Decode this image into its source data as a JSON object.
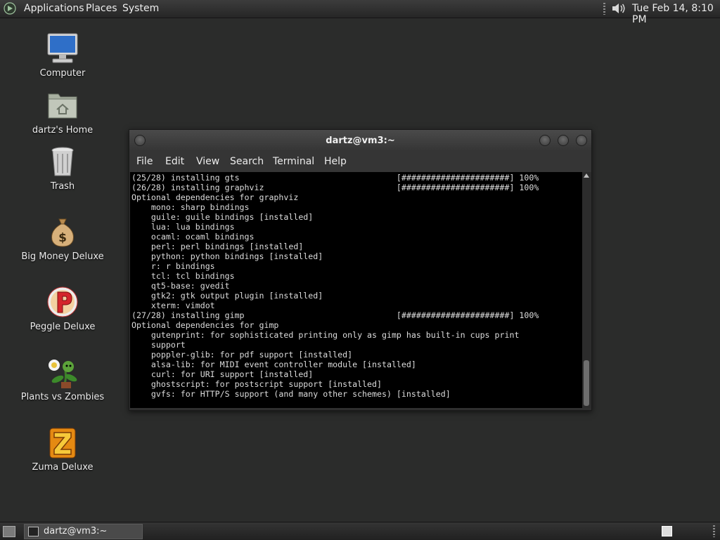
{
  "top_panel": {
    "menus": [
      "Applications",
      "Places",
      "System"
    ],
    "clock": "Tue Feb 14,  8:10 PM"
  },
  "desktop": {
    "icons": [
      {
        "label": "Computer",
        "icon": "computer-icon"
      },
      {
        "label": "dartz's Home",
        "icon": "home-folder-icon"
      },
      {
        "label": "Trash",
        "icon": "trash-icon"
      },
      {
        "label": "Big Money Deluxe",
        "icon": "money-bag-icon"
      },
      {
        "label": "Peggle Deluxe",
        "icon": "peggle-icon"
      },
      {
        "label": "Plants vs Zombies",
        "icon": "plants-vs-zombies-icon"
      },
      {
        "label": "Zuma Deluxe",
        "icon": "zuma-icon"
      }
    ]
  },
  "terminal": {
    "title": "dartz@vm3:~",
    "menu": [
      "File",
      "Edit",
      "View",
      "Search",
      "Terminal",
      "Help"
    ],
    "lines": [
      "(25/28) installing gts                                [######################] 100%",
      "(26/28) installing graphviz                           [######################] 100%",
      "Optional dependencies for graphviz",
      "    mono: sharp bindings",
      "    guile: guile bindings [installed]",
      "    lua: lua bindings",
      "    ocaml: ocaml bindings",
      "    perl: perl bindings [installed]",
      "    python: python bindings [installed]",
      "    r: r bindings",
      "    tcl: tcl bindings",
      "    qt5-base: gvedit",
      "    gtk2: gtk output plugin [installed]",
      "    xterm: vimdot",
      "(27/28) installing gimp                               [######################] 100%",
      "Optional dependencies for gimp",
      "    gutenprint: for sophisticated printing only as gimp has built-in cups print",
      "    support",
      "    poppler-glib: for pdf support [installed]",
      "    alsa-lib: for MIDI event controller module [installed]",
      "    curl: for URI support [installed]",
      "    ghostscript: for postscript support [installed]",
      "    gvfs: for HTTP/S support (and many other schemes) [installed]"
    ]
  },
  "taskbar": {
    "tasks": [
      {
        "label": "dartz@vm3:~"
      }
    ]
  }
}
